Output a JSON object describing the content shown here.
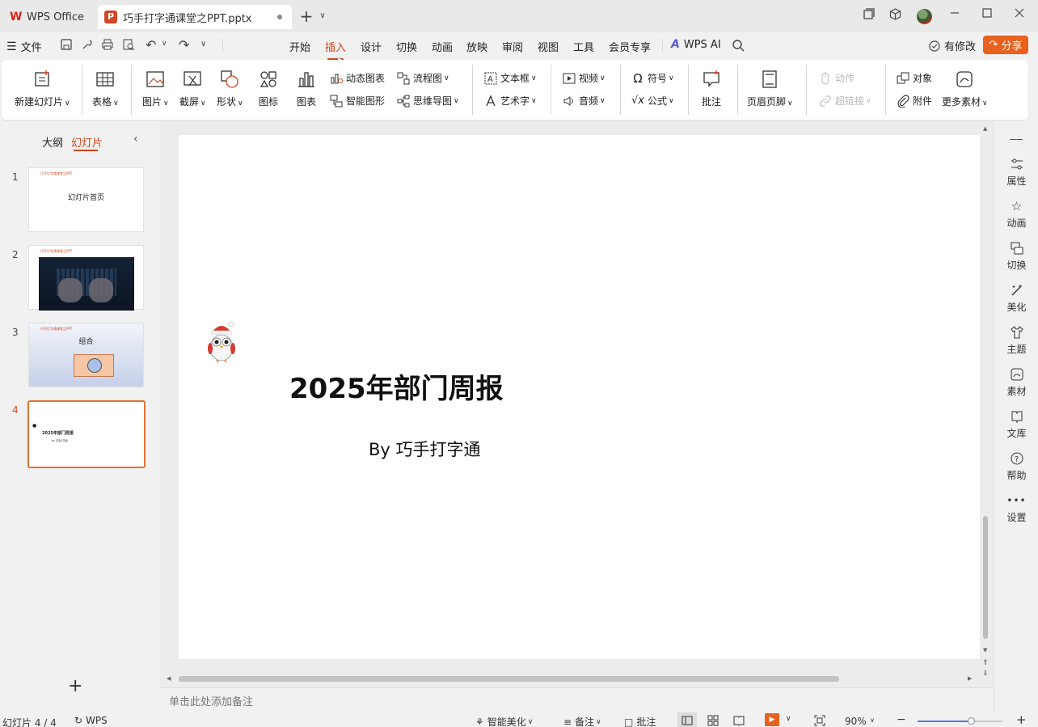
{
  "titlebar": {
    "home_tab": "WPS Office",
    "doc_tab": "巧手打字通课堂之PPT.pptx"
  },
  "menu": {
    "file": "文件",
    "tabs": [
      "开始",
      "插入",
      "设计",
      "切换",
      "动画",
      "放映",
      "审阅",
      "视图",
      "工具",
      "会员专享"
    ],
    "active_tab": "插入",
    "wps_ai": "WPS AI",
    "modified": "有修改",
    "share": "分享"
  },
  "ribbon": {
    "new_slide": "新建幻灯片",
    "table": "表格",
    "picture": "图片",
    "screenshot": "截屏",
    "shape": "形状",
    "icon": "图标",
    "chart": "图表",
    "dynamic_chart": "动态图表",
    "smart_graphic": "智能图形",
    "flowchart": "流程图",
    "mindmap": "思维导图",
    "textbox": "文本框",
    "wordart": "艺术字",
    "video": "视频",
    "audio": "音频",
    "symbol": "符号",
    "formula": "公式",
    "comment": "批注",
    "header_footer": "页眉页脚",
    "action": "动作",
    "hyperlink": "超链接",
    "object": "对象",
    "attachment": "附件",
    "more_materials": "更多素材"
  },
  "leftpanel": {
    "outline_tab": "大纲",
    "slides_tab": "幻灯片",
    "active_tab": "幻灯片",
    "thumbs": [
      {
        "num": "1",
        "title": "幻灯片首页",
        "header": "巧手打字通课堂之PPT"
      },
      {
        "num": "2",
        "header": "巧手打字通课堂之PPT"
      },
      {
        "num": "3",
        "title": "组合",
        "header": "巧手打字通课堂之PPT"
      },
      {
        "num": "4",
        "title": "2025年部门周报",
        "subtitle": "By 巧手打字通"
      }
    ],
    "add": "+"
  },
  "slide": {
    "title": "2025年部门周报",
    "subtitle": "By 巧手打字通"
  },
  "notes": {
    "placeholder": "单击此处添加备注"
  },
  "rightpanel": [
    "属性",
    "动画",
    "切换",
    "美化",
    "主题",
    "素材",
    "文库",
    "帮助",
    "设置"
  ],
  "status": {
    "slide_count": "幻灯片 4 / 4",
    "wps": "WPS",
    "smart_beautify": "智能美化",
    "notes": "备注",
    "comments": "批注",
    "zoom": "90%",
    "zoom_fraction": 0.63
  },
  "colors": {
    "accent": "#d0471d",
    "share_bg": "#e8611f"
  }
}
